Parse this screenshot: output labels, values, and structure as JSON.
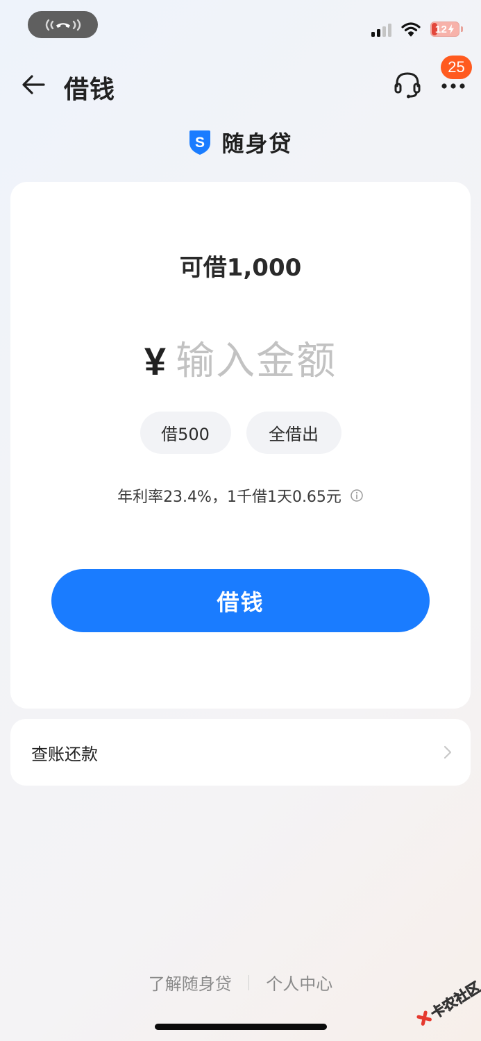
{
  "status_bar": {
    "battery": "12"
  },
  "nav": {
    "title": "借钱",
    "badge_count": "25"
  },
  "brand": {
    "logo_letter": "S",
    "name": "随身贷"
  },
  "loan": {
    "available_text": "可借1,000",
    "currency_symbol": "¥",
    "amount_placeholder": "输入金额",
    "quick_options": [
      "借500",
      "全借出"
    ],
    "rate_text": "年利率23.4%，1千借1天0.65元",
    "submit_label": "借钱"
  },
  "bill": {
    "label": "查账还款"
  },
  "footer": {
    "links": [
      "了解随身贷",
      "个人中心"
    ]
  },
  "watermark": {
    "text": "卡农社区"
  },
  "colors": {
    "primary": "#1a7cff",
    "badge": "#ff5a1f",
    "battery_low": "#e2463b"
  }
}
